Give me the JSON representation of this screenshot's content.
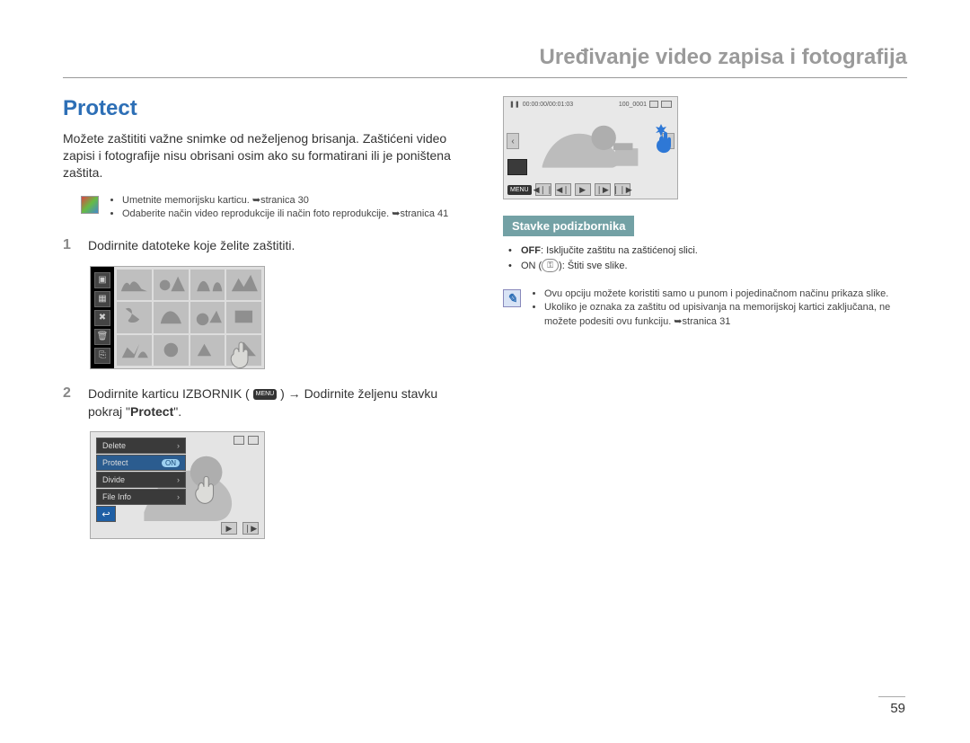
{
  "header": {
    "title": "Uređivanje video zapisa i fotografija"
  },
  "section_title": "Protect",
  "intro": "Možete zaštititi važne snimke od neželjenog brisanja. Zaštićeni video zapisi i fotografije nisu obrisani osim ako su formatirani ili je poništena zaštita.",
  "pre": {
    "b1": "Umetnite memorijsku karticu. ➥stranica 30",
    "b2": "Odaberite način video reprodukcije ili način foto reprodukcije. ➥stranica 41"
  },
  "step1": {
    "num": "1",
    "text": "Dodirnite datoteke koje želite zaštititi."
  },
  "step2": {
    "num": "2",
    "pre": "Dodirnite karticu IZBORNIK (",
    "chip": "MENU",
    "mid": ") → Dodirnite željenu stavku pokraj \"",
    "bold": "Protect",
    "post": "\"."
  },
  "fig2menu": {
    "delete": "Delete",
    "protect": "Protect",
    "on": "ON",
    "divide": "Divide",
    "fileinfo": "File Info"
  },
  "fig3": {
    "time": "00:00:00/00:01:03",
    "file": "100_0001"
  },
  "sub": {
    "heading": "Stavke podizbornika",
    "off_b": "OFF",
    "off_t": ": Isključite zaštitu na zaštićenoj slici.",
    "on_l": "ON (",
    "on_r": "): Štiti sve slike."
  },
  "notes": {
    "n1": "Ovu opciju možete koristiti samo u punom i pojedinačnom načinu prikaza slike.",
    "n2": "Ukoliko je oznaka za zaštitu od upisivanja na memorijskoj kartici zaključana, ne možete podesiti ovu funkciju. ➥stranica 31"
  },
  "page_number": "59"
}
